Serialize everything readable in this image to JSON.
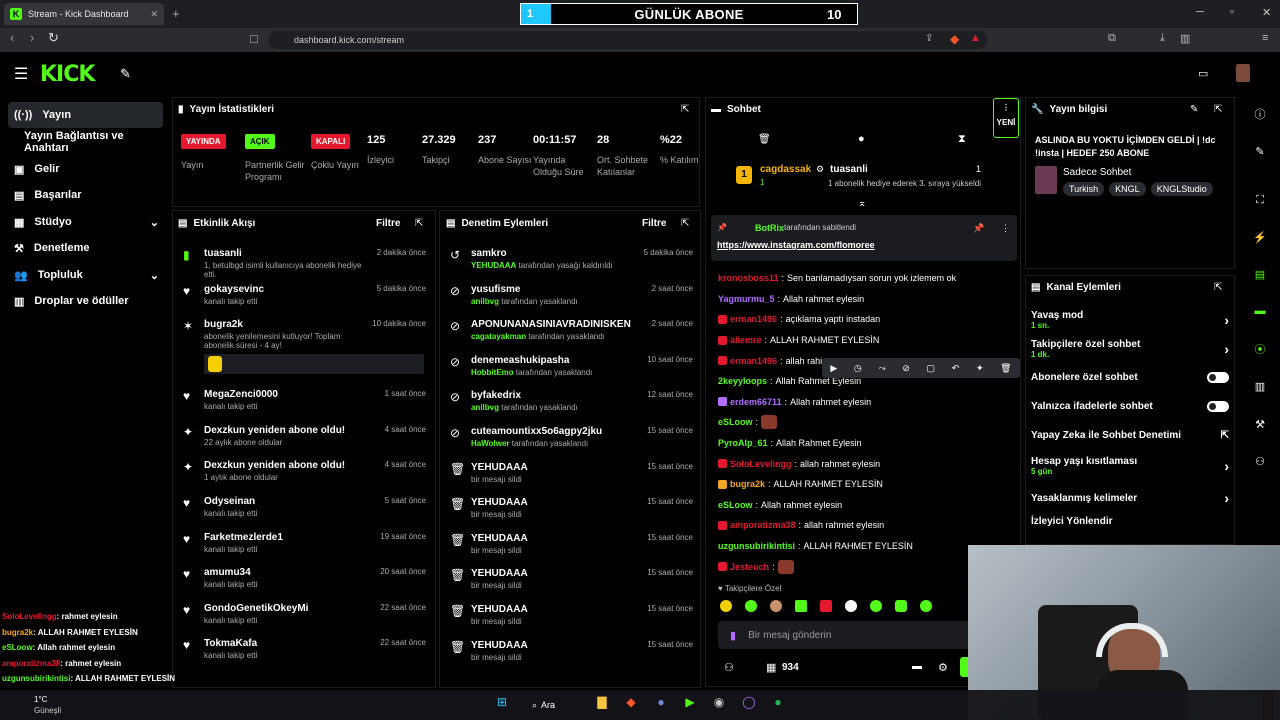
{
  "browser": {
    "tab_title": "Stream - Kick Dashboard",
    "url": "dashboard.kick.com/stream"
  },
  "goal": {
    "current": "1",
    "title": "GÜNLÜK ABONE",
    "target": "10",
    "progress": 0.1
  },
  "sidebar": {
    "items": [
      {
        "label": "Yayın",
        "icon": "broadcast-icon"
      },
      {
        "label": "Yayın Bağlantısı ve Anahtarı"
      },
      {
        "label": "Gelir",
        "icon": "revenue-icon"
      },
      {
        "label": "Başarılar",
        "icon": "achievement-icon"
      },
      {
        "label": "Stüdyo",
        "icon": "studio-icon"
      },
      {
        "label": "Denetleme",
        "icon": "moderation-icon"
      },
      {
        "label": "Topluluk",
        "icon": "community-icon"
      },
      {
        "label": "Droplar ve ödüller",
        "icon": "drops-icon"
      }
    ]
  },
  "stats": {
    "title": "Yayın İstatistikleri",
    "items": [
      {
        "badge": "YAYINDA",
        "badge_color": "#e5182e",
        "label": "Yayın"
      },
      {
        "badge": "AÇIK",
        "badge_color": "#53fc18",
        "label": "Partnerlik Gelir Programı"
      },
      {
        "badge": "KAPALI",
        "badge_color": "#e5182e",
        "label": "Çoklu Yayın"
      },
      {
        "value": "125",
        "label": "İzleyici"
      },
      {
        "value": "27.329",
        "label": "Takipçi"
      },
      {
        "value": "237",
        "label": "Abone Sayısı"
      },
      {
        "value": "00:11:57",
        "label": "Yayında Olduğu Süre"
      },
      {
        "value": "28",
        "label": "Ort. Sohbete Katılanlar"
      },
      {
        "value": "%22",
        "label": "% Katılım"
      }
    ]
  },
  "activity": {
    "title": "Etkinlik Akışı",
    "filter": "Filtre",
    "items": [
      {
        "icon": "gift-icon",
        "name": "tuasanli",
        "time": "2 dakika önce",
        "sub": "1, betulbgd isimli kullanıcıya abonelik hediye etti.",
        "green": true
      },
      {
        "icon": "heart-icon",
        "name": "gokaysevinc",
        "time": "5 dakika önce",
        "sub": "kanalı takip etti"
      },
      {
        "icon": "celebrate-icon",
        "name": "bugra2k",
        "time": "10 dakika önce",
        "sub": "abonelik yenilemesini kutluyor! Toplam abonelik süresi - 4 ay!",
        "tall": true
      },
      {
        "icon": "heart-icon",
        "name": "MegaZenci0000",
        "time": "1 saat önce",
        "sub": "kanalı takip etti"
      },
      {
        "icon": "sparkle-icon",
        "name": "Dexzkun yeniden abone oldu!",
        "time": "4 saat önce",
        "sub": "22 aylık abone oldular"
      },
      {
        "icon": "sparkle-icon",
        "name": "Dexzkun yeniden abone oldu!",
        "time": "4 saat önce",
        "sub": "1 aylık abone oldular"
      },
      {
        "icon": "heart-icon",
        "name": "Odyseinan",
        "time": "5 saat önce",
        "sub": "kanalı takip etti"
      },
      {
        "icon": "heart-icon",
        "name": "Farketmezlerde1",
        "time": "19 saat önce",
        "sub": "kanalı takip etti"
      },
      {
        "icon": "heart-icon",
        "name": "amumu34",
        "time": "20 saat önce",
        "sub": "kanalı takip etti"
      },
      {
        "icon": "heart-icon",
        "name": "GondoGenetikOkeyMi",
        "time": "22 saat önce",
        "sub": "kanalı takip etti"
      },
      {
        "icon": "heart-icon",
        "name": "TokmaKafa",
        "time": "22 saat önce",
        "sub": "kanalı takip etti"
      }
    ]
  },
  "moderation": {
    "title": "Denetim Eylemleri",
    "filter": "Filtre",
    "items": [
      {
        "icon": "unban-icon",
        "name": "samkro",
        "time": "5 dakika önce",
        "by": "YEHUDAAA",
        "sub": "tarafından yasağı kaldırıldı"
      },
      {
        "icon": "ban-icon",
        "name": "yusufisme",
        "time": "2 saat önce",
        "by": "anilbvg",
        "sub": "tarafından yasaklandı"
      },
      {
        "icon": "ban-icon",
        "name": "APONUNANASINIAVRADINISKEN",
        "time": "2 saat önce",
        "by": "cagatayakman",
        "sub": "tarafından yasaklandı"
      },
      {
        "icon": "ban-icon",
        "name": "denemeashukipasha",
        "time": "10 saat önce",
        "by": "HobbitEmo",
        "sub": "tarafından yasaklandı"
      },
      {
        "icon": "ban-icon",
        "name": "byfakedrix",
        "time": "12 saat önce",
        "by": "anilbvg",
        "sub": "tarafından yasaklandı"
      },
      {
        "icon": "ban-icon",
        "name": "cuteamountixx5o6agpy2jku",
        "time": "15 saat önce",
        "by": "HaWolwer",
        "sub": "tarafından yasaklandı"
      },
      {
        "icon": "trash-icon",
        "name": "YEHUDAAA",
        "time": "15 saat önce",
        "sub": "bir mesajı sildi"
      },
      {
        "icon": "trash-icon",
        "name": "YEHUDAAA",
        "time": "15 saat önce",
        "sub": "bir mesajı sildi"
      },
      {
        "icon": "trash-icon",
        "name": "YEHUDAAA",
        "time": "15 saat önce",
        "sub": "bir mesajı sildi"
      },
      {
        "icon": "trash-icon",
        "name": "YEHUDAAA",
        "time": "15 saat önce",
        "sub": "bir mesajı sildi"
      },
      {
        "icon": "trash-icon",
        "name": "YEHUDAAA",
        "time": "15 saat önce",
        "sub": "bir mesajı sildi"
      },
      {
        "icon": "trash-icon",
        "name": "YEHUDAAA",
        "time": "15 saat önce",
        "sub": "bir mesajı sildi"
      }
    ]
  },
  "chat": {
    "title": "Sohbet",
    "new_label": "YENİ",
    "gift": {
      "gifter": "cagdassak",
      "gifter_count": "1",
      "user": "tuasanli",
      "user_count": "1",
      "text": "1 abonelik hediye ederek 3. sıraya yükseldi"
    },
    "pinned": {
      "by": "BotRix",
      "by_text": "tarafından sabitlendi",
      "link": "https://www.instagram.com/flomoree"
    },
    "messages": [
      {
        "user": "kronosboss11",
        "color": "#e5182e",
        "text": "Sen banlamadıysan sorun yok izlemem ok"
      },
      {
        "user": "Yagmurmu_5",
        "color": "#b36cff",
        "text": "Allah rahmet eylesin"
      },
      {
        "user": "erman1496",
        "color": "#e5182e",
        "text": "açıklama yaptı instadan"
      },
      {
        "user": "aliemre",
        "color": "#e5182e",
        "text": "ALLAH RAHMET EYLESİN"
      },
      {
        "user": "erman1496",
        "color": "#e5182e",
        "text": "allah rahi"
      },
      {
        "user": "2keyyloops",
        "color": "#53fc18",
        "text": "Allah Rahmet Eylesin"
      },
      {
        "user": "erdem66711",
        "color": "#b36cff",
        "text": "Allah rahmet eylesin"
      },
      {
        "user": "eSLoow",
        "color": "#53fc18",
        "text": ""
      },
      {
        "user": "PyroAlp_61",
        "color": "#53fc18",
        "text": "Allah Rahmet Eylesin"
      },
      {
        "user": "SoloLevelingg",
        "color": "#e5182e",
        "text": "allah rahmet eylesin"
      },
      {
        "user": "bugra2k",
        "color": "#f5a623",
        "text": "ALLAH RAHMET EYLESİN"
      },
      {
        "user": "eSLoow",
        "color": "#53fc18",
        "text": "Allah rahmet eylesin"
      },
      {
        "user": "amporatizma38",
        "color": "#e5182e",
        "text": "allah rahmet eylesin"
      },
      {
        "user": "uzgunsubirikintisi",
        "color": "#53fc18",
        "text": "ALLAH RAHMET EYLESİN"
      },
      {
        "user": "Jesteuch",
        "color": "#e5182e",
        "text": ""
      }
    ],
    "followers_only": "Takipçilere Özel",
    "input_placeholder": "Bir mesaj gönderin",
    "viewer_count": "934"
  },
  "stream_info": {
    "title": "Yayın bilgisi",
    "stream_title": "ASLINDA BU YOKTU İÇİMDEN GELDİ | !dc !insta | HEDEF 250 ABONE",
    "category": "Sadece Sohbet",
    "tags": [
      "Turkish",
      "KNGL",
      "KNGLStudio"
    ]
  },
  "channel_actions": {
    "title": "Kanal Eylemleri",
    "items": [
      {
        "label": "Yavaş mod",
        "sub": "1 sn.",
        "control": "arrow"
      },
      {
        "label": "Takipçilere özel sohbet",
        "sub": "1 dk.",
        "control": "arrow"
      },
      {
        "label": "Abonelere özel sohbet",
        "control": "toggle"
      },
      {
        "label": "Yalnızca ifadelerle sohbet",
        "control": "toggle"
      },
      {
        "label": "Yapay Zeka ile Sohbet Denetimi",
        "control": "external"
      },
      {
        "label": "Hesap yaşı kısıtlaması",
        "sub": "5 gün",
        "control": "arrow"
      },
      {
        "label": "Yasaklanmış kelimeler",
        "control": "arrow"
      },
      {
        "label": "İzleyici Yönlendir",
        "control": "none"
      }
    ]
  },
  "overlay_chat": [
    {
      "user": "SoloLevelingg",
      "color": "#e5182e",
      "text": "rahmet eylesin"
    },
    {
      "user": "bugra2k",
      "color": "#f5a623",
      "text": "ALLAH RAHMET EYLESİN"
    },
    {
      "user": "eSLoow",
      "color": "#53fc18",
      "text": "Allah rahmet eylesin"
    },
    {
      "user": "amporatizma38",
      "color": "#e5182e",
      "text": "rahmet eylesin"
    },
    {
      "user": "uzgunsubirikintisi",
      "color": "#53fc18",
      "text": "ALLAH RAHMET EYLESİN"
    }
  ],
  "taskbar": {
    "search": "Ara",
    "weather": "Güneşli",
    "temp": "1°C"
  }
}
